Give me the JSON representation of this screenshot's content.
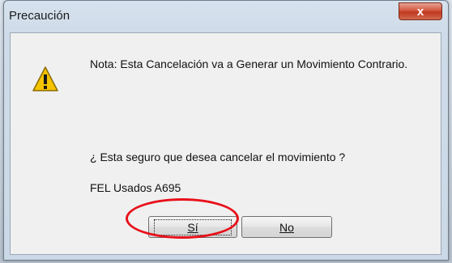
{
  "dialog": {
    "title": "Precaución",
    "close_label": "x",
    "note": "Nota: Esta Cancelación va a Generar un Movimiento Contrario.",
    "question": "¿ Esta seguro que desea cancelar el movimiento ?",
    "item": "FEL Usados A695",
    "buttons": {
      "yes": "Sí",
      "no": "No"
    }
  },
  "colors": {
    "annotation_ring": "#e8101a",
    "close_button": "#c0381f",
    "warning_icon": "#f5c400"
  },
  "icons": [
    "warning-icon",
    "close-icon"
  ]
}
